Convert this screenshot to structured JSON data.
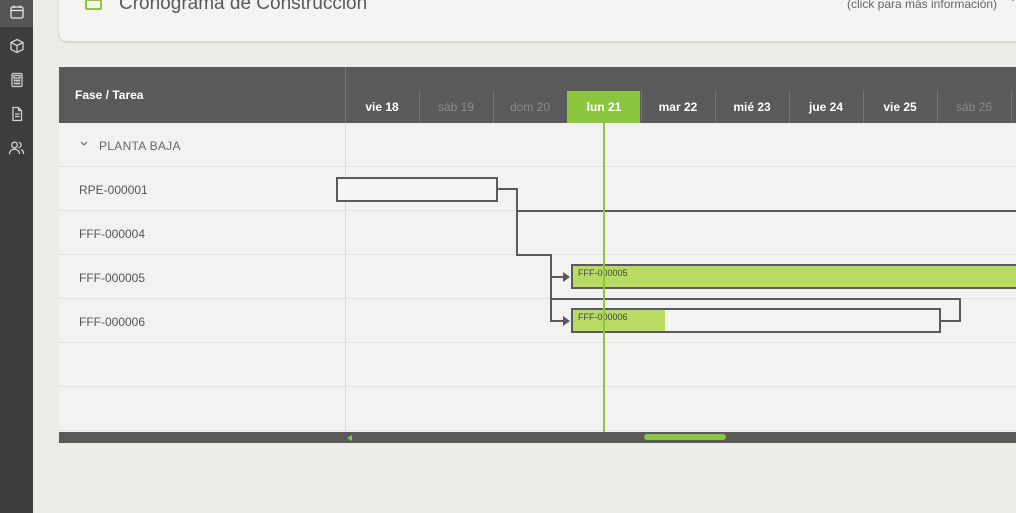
{
  "header": {
    "title": "Cronograma de Construcción",
    "hint": "(click para más información)"
  },
  "sidebar": {
    "items": [
      {
        "icon": "calendar-icon",
        "active": true
      },
      {
        "icon": "box-icon"
      },
      {
        "icon": "calculator-icon"
      },
      {
        "icon": "document-icon"
      },
      {
        "icon": "users-icon"
      }
    ]
  },
  "gantt": {
    "column_header": "Fase / Tarea",
    "days": [
      {
        "label": "vie 18"
      },
      {
        "label": "sáb 19",
        "weekend": true
      },
      {
        "label": "dom 20",
        "weekend": true
      },
      {
        "label": "lun 21",
        "today": true
      },
      {
        "label": "mar 22"
      },
      {
        "label": "mié 23"
      },
      {
        "label": "jue 24"
      },
      {
        "label": "vie 25"
      },
      {
        "label": "sáb 26",
        "weekend": true
      }
    ],
    "group": "PLANTA BAJA",
    "rows": [
      "RPE-000001",
      "FFF-000004",
      "FFF-000005",
      "FFF-000006"
    ],
    "bars": {
      "fff5": {
        "label": "FFF-000005",
        "progress": 1.0
      },
      "fff6": {
        "label": "FFF-000006",
        "progress": 0.25
      }
    }
  },
  "colors": {
    "accent": "#8cc63f",
    "bar_fill": "#b8db62",
    "header_bg": "#5a5a5a",
    "sidebar_bg": "#3d3d3d"
  }
}
